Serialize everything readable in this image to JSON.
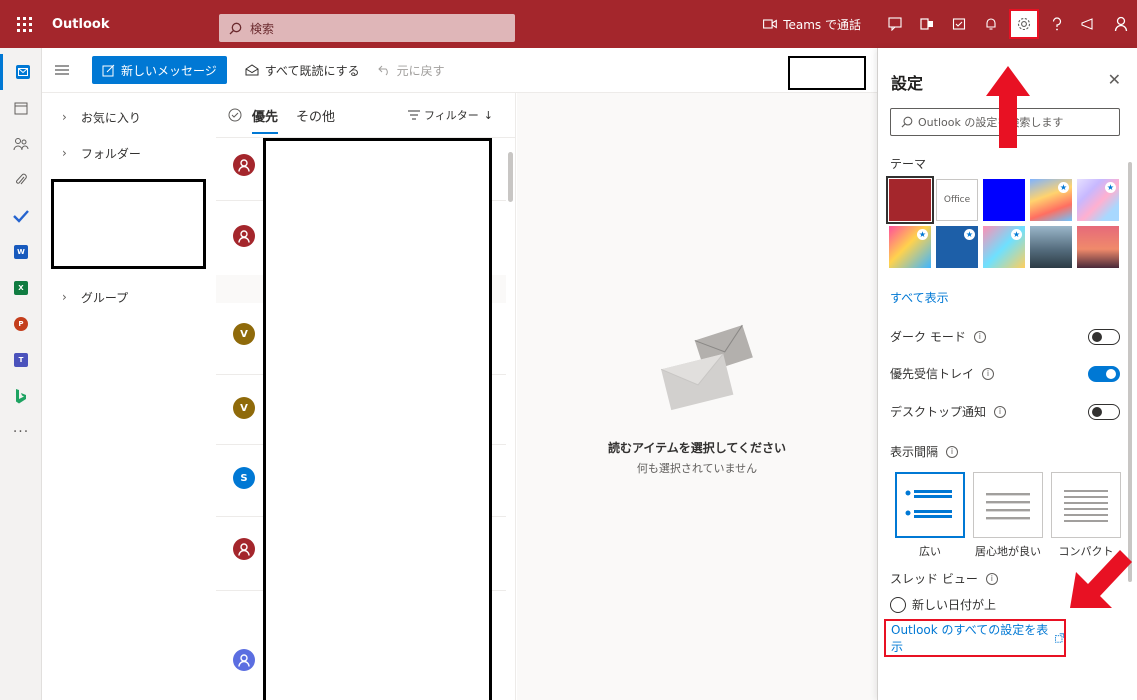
{
  "topbar": {
    "app_name": "Outlook",
    "search_placeholder": "検索",
    "teams_call": "Teams で通話",
    "accent": "#a4262c"
  },
  "commands": {
    "new_message": "新しいメッセージ",
    "mark_all_read": "すべて既読にする",
    "undo": "元に戻す"
  },
  "folders": {
    "favorites": "お気に入り",
    "folders": "フォルダー",
    "groups": "グループ"
  },
  "list": {
    "tab_focused": "優先",
    "tab_other": "その他",
    "filter": "フィルター",
    "avatars": [
      {
        "letter": "",
        "color": "#a4262c"
      },
      {
        "letter": "",
        "color": "#a4262c"
      },
      {
        "letter": "V",
        "color": "#8f6a0a"
      },
      {
        "letter": "V",
        "color": "#8f6a0a"
      },
      {
        "letter": "S",
        "color": "#0078d4"
      },
      {
        "letter": "",
        "color": "#a4262c"
      },
      {
        "letter": "",
        "color": "#5b6ee1"
      }
    ]
  },
  "reading": {
    "title": "読むアイテムを選択してください",
    "subtitle": "何も選択されていません"
  },
  "settings": {
    "title": "設定",
    "search_placeholder": "Outlook の設定を検索します",
    "theme_label": "テーマ",
    "office_theme": "Office",
    "show_all": "すべて表示",
    "dark_mode": "ダーク モード",
    "focused_inbox": "優先受信トレイ",
    "desktop_notifications": "デスクトップ通知",
    "density_label": "表示間隔",
    "density_options": [
      "広い",
      "居心地が良い",
      "コンパクト"
    ],
    "thread_view": "スレッド ビュー",
    "newest_on_top": "新しい日付が上",
    "view_all_settings": "Outlook のすべての設定を表示",
    "toggles": {
      "dark_mode": false,
      "focused_inbox": true,
      "desktop_notifications": false
    }
  }
}
